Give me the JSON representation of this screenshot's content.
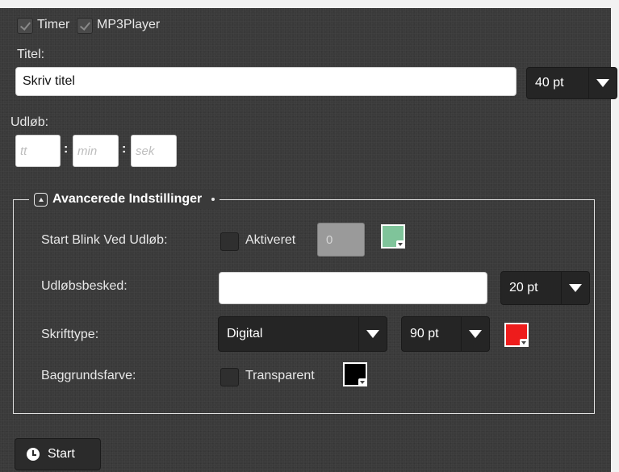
{
  "options": {
    "timer": {
      "label": "Timer",
      "checked": true
    },
    "mp3player": {
      "label": "MP3Player",
      "checked": true
    }
  },
  "title_section": {
    "label": "Titel:",
    "value": "Skriv titel",
    "size": "40 pt"
  },
  "expiry": {
    "label": "Udløb:",
    "hours_placeholder": "tt",
    "minutes_placeholder": "min",
    "seconds_placeholder": "sek",
    "separator": ":"
  },
  "advanced": {
    "title": "Avancerede Indstillinger",
    "blink": {
      "label": "Start Blink Ved Udløb:",
      "checkbox_label": "Aktiveret",
      "value": "0",
      "color": "#7fc49a"
    },
    "message": {
      "label": "Udløbsbesked:",
      "value": "",
      "size": "20 pt"
    },
    "font": {
      "label": "Skrifttype:",
      "family": "Digital",
      "size": "90 pt",
      "color": "#ee1c1c"
    },
    "background": {
      "label": "Baggrundsfarve:",
      "checkbox_label": "Transparent",
      "color": "#000000"
    }
  },
  "start_button": {
    "label": "Start",
    "icon": "clock-icon"
  }
}
